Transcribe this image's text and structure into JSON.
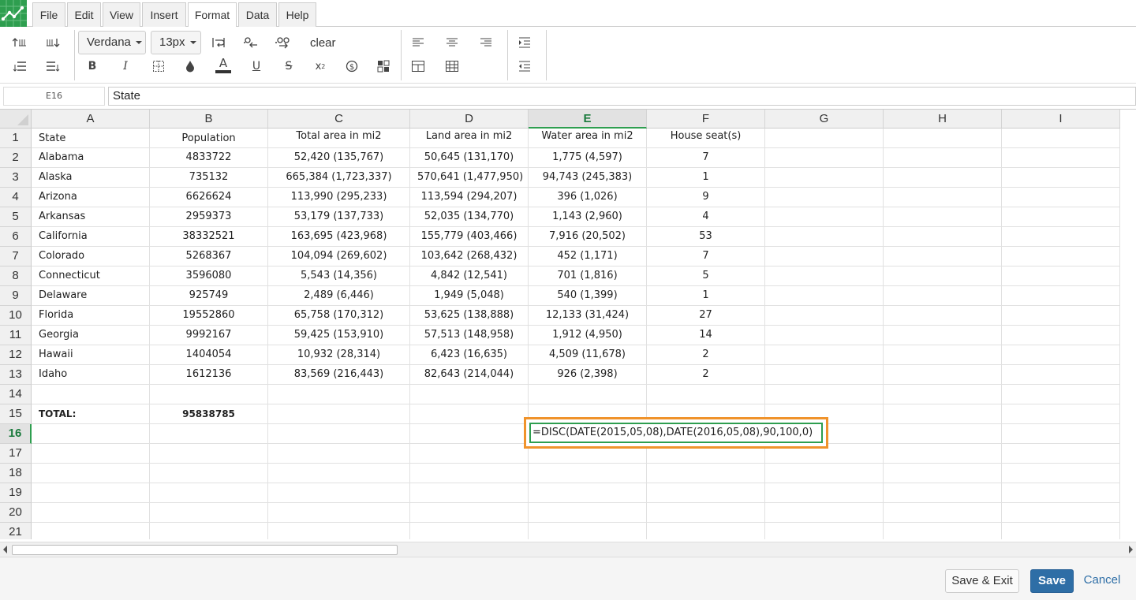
{
  "menu": {
    "tabs": [
      "File",
      "Edit",
      "View",
      "Insert",
      "Format",
      "Data",
      "Help"
    ],
    "active_tab": "Format"
  },
  "toolbar": {
    "font_family": "Verdana",
    "font_size": "13px",
    "clear_label": "clear",
    "icons": [
      "insert-row-above-icon",
      "insert-row-below-icon",
      "decrease-indent-icon",
      "increase-indent-icon",
      "wrap-text-icon",
      "decrease-decimal-icon",
      "increase-decimal-icon",
      "bold-icon",
      "italic-icon",
      "borders-icon",
      "fill-color-icon",
      "text-color-icon",
      "underline-icon",
      "strikethrough-icon",
      "superscript-icon",
      "currency-icon",
      "format-icon",
      "align-left-icon",
      "align-center-icon",
      "align-right-icon",
      "merge-cells-icon",
      "unmerge-cells-icon",
      "indent-icon",
      "outdent-icon"
    ]
  },
  "formula_bar": {
    "cell_ref": "E16",
    "value": "State"
  },
  "grid": {
    "columns": [
      "A",
      "B",
      "C",
      "D",
      "E",
      "F",
      "G",
      "H",
      "I"
    ],
    "active_column": "E",
    "active_row": "16",
    "rows": [
      {
        "num": "1",
        "cells": [
          "State",
          "Population",
          "Total area in mi2",
          "Land area in mi2",
          "Water area in mi2",
          "House seat(s)"
        ]
      },
      {
        "num": "2",
        "cells": [
          "Alabama",
          "4833722",
          "52,420 (135,767)",
          "50,645 (131,170)",
          "1,775 (4,597)",
          "7"
        ]
      },
      {
        "num": "3",
        "cells": [
          "Alaska",
          "735132",
          "665,384 (1,723,337)",
          "570,641 (1,477,950)",
          "94,743 (245,383)",
          "1"
        ]
      },
      {
        "num": "4",
        "cells": [
          "Arizona",
          "6626624",
          "113,990 (295,233)",
          "113,594 (294,207)",
          "396 (1,026)",
          "9"
        ]
      },
      {
        "num": "5",
        "cells": [
          "Arkansas",
          "2959373",
          "53,179 (137,733)",
          "52,035 (134,770)",
          "1,143 (2,960)",
          "4"
        ]
      },
      {
        "num": "6",
        "cells": [
          "California",
          "38332521",
          "163,695 (423,968)",
          "155,779 (403,466)",
          "7,916 (20,502)",
          "53"
        ]
      },
      {
        "num": "7",
        "cells": [
          "Colorado",
          "5268367",
          "104,094 (269,602)",
          "103,642 (268,432)",
          "452 (1,171)",
          "7"
        ]
      },
      {
        "num": "8",
        "cells": [
          "Connecticut",
          "3596080",
          "5,543 (14,356)",
          "4,842 (12,541)",
          "701 (1,816)",
          "5"
        ]
      },
      {
        "num": "9",
        "cells": [
          "Delaware",
          "925749",
          "2,489 (6,446)",
          "1,949 (5,048)",
          "540 (1,399)",
          "1"
        ]
      },
      {
        "num": "10",
        "cells": [
          "Florida",
          "19552860",
          "65,758 (170,312)",
          "53,625 (138,888)",
          "12,133 (31,424)",
          "27"
        ]
      },
      {
        "num": "11",
        "cells": [
          "Georgia",
          "9992167",
          "59,425 (153,910)",
          "57,513 (148,958)",
          "1,912 (4,950)",
          "14"
        ]
      },
      {
        "num": "12",
        "cells": [
          "Hawaii",
          "1404054",
          "10,932 (28,314)",
          "6,423 (16,635)",
          "4,509 (11,678)",
          "2"
        ]
      },
      {
        "num": "13",
        "cells": [
          "Idaho",
          "1612136",
          "83,569 (216,443)",
          "82,643 (214,044)",
          "926 (2,398)",
          "2"
        ]
      },
      {
        "num": "14",
        "cells": [
          "",
          "",
          "",
          "",
          "",
          ""
        ]
      },
      {
        "num": "15",
        "cells": [
          "TOTAL:",
          "95838785",
          "",
          "",
          "",
          ""
        ]
      },
      {
        "num": "16",
        "cells": [
          "",
          "",
          "",
          "",
          "",
          ""
        ]
      },
      {
        "num": "17",
        "cells": [
          "",
          "",
          "",
          "",
          "",
          ""
        ]
      },
      {
        "num": "18",
        "cells": [
          "",
          "",
          "",
          "",
          "",
          ""
        ]
      },
      {
        "num": "19",
        "cells": [
          "",
          "",
          "",
          "",
          "",
          ""
        ]
      },
      {
        "num": "20",
        "cells": [
          "",
          "",
          "",
          "",
          "",
          ""
        ]
      },
      {
        "num": "21",
        "cells": [
          "",
          "",
          "",
          "",
          "",
          ""
        ]
      }
    ],
    "editor_value": "=DISC(DATE(2015,05,08),DATE(2016,05,08),90,100,0)"
  },
  "footer": {
    "save_exit_label": "Save & Exit",
    "save_label": "Save",
    "cancel_label": "Cancel"
  },
  "colors": {
    "accent_green": "#2e9e4f",
    "highlight_orange": "#f0932b",
    "primary_blue": "#2e6ea6"
  }
}
